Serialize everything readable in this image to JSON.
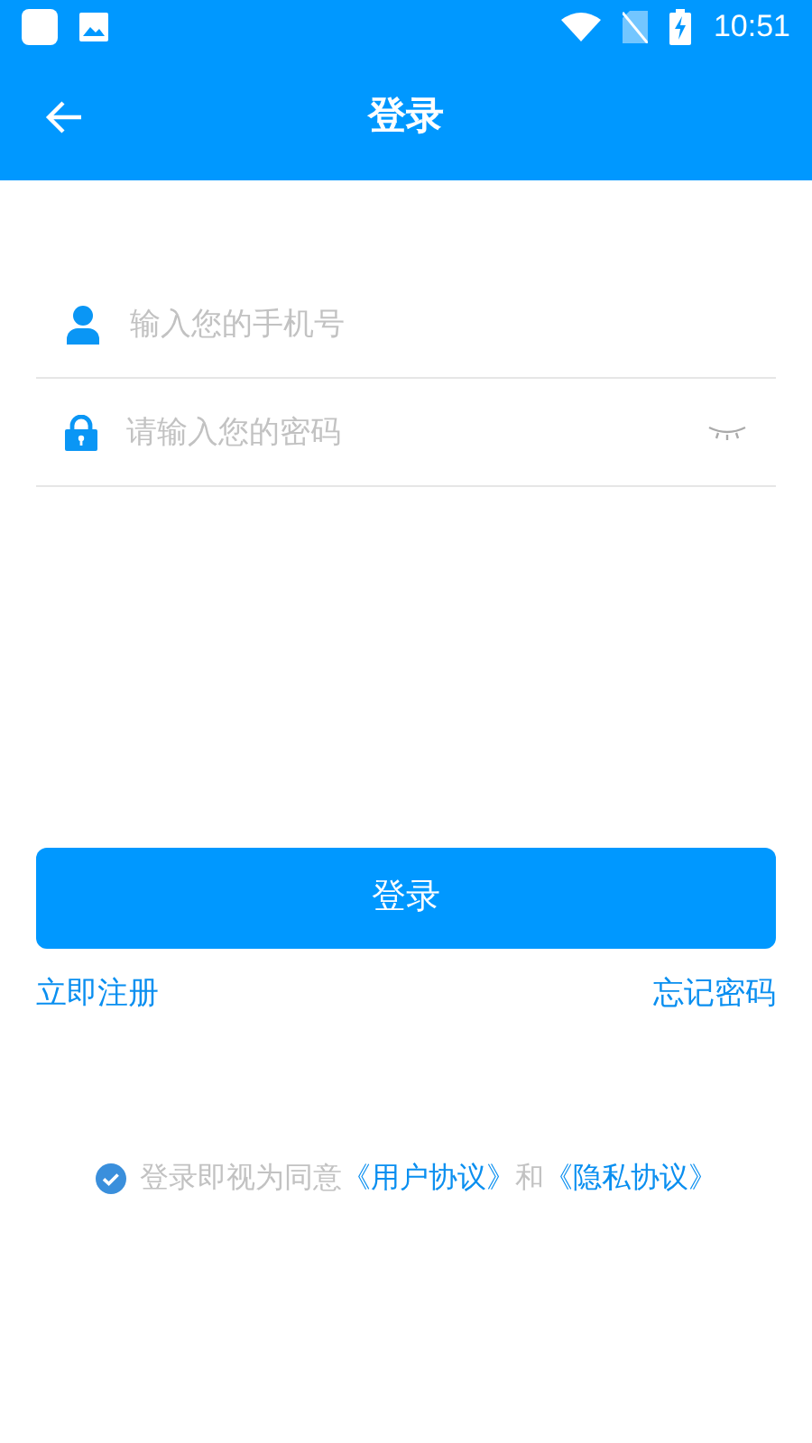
{
  "status_bar": {
    "time": "10:51"
  },
  "app_bar": {
    "title": "登录"
  },
  "fields": [
    {
      "kind": "phone",
      "placeholder": "输入您的手机号"
    },
    {
      "kind": "password",
      "placeholder": "请输入您的密码"
    }
  ],
  "login_button": "登录",
  "register_link": "立即注册",
  "forgot_link": "忘记密码",
  "agreement": {
    "checked": true,
    "prefix": "登录即视为同意",
    "links": [
      "《用户协议》",
      "《隐私协议》"
    ],
    "conjunction": "和"
  }
}
